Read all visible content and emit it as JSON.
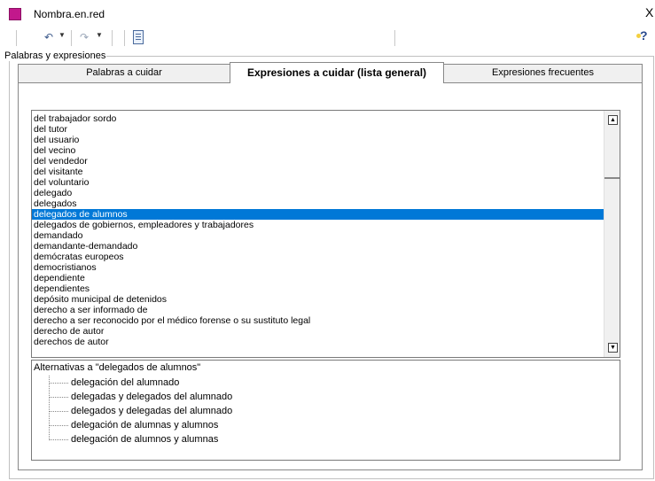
{
  "window": {
    "title": "Nombra.en.red",
    "close_glyph": "X"
  },
  "toolbar": {
    "undo_glyph": "↶",
    "redo_glyph": "↷",
    "dropdown_glyph": "▼",
    "help_glyph": "?"
  },
  "group": {
    "label": "Palabras y expresiones"
  },
  "tabs": [
    {
      "label": "Palabras a cuidar"
    },
    {
      "label": "Expresiones a cuidar (lista general)"
    },
    {
      "label": "Expresiones frecuentes"
    }
  ],
  "active_tab": 1,
  "list": {
    "items": [
      "del trabajador sordo",
      "del tutor",
      "del usuario",
      "del vecino",
      "del vendedor",
      "del visitante",
      "del voluntario",
      "delegado",
      "delegados",
      "delegados de alumnos",
      "delegados de gobiernos, empleadores y trabajadores",
      "demandado",
      "demandante-demandado",
      "demócratas europeos",
      "democristianos",
      "dependiente",
      "dependientes",
      "depósito municipal de detenidos",
      "derecho a ser informado de",
      "derecho a ser reconocido por el médico forense o su sustituto legal",
      "derecho de autor",
      "derechos de autor"
    ],
    "selected_index": 9,
    "scroll_up_glyph": "▲",
    "scroll_down_glyph": "▼"
  },
  "alternatives": {
    "header": "Alternativas a \"delegados de alumnos\"",
    "items": [
      "delegación del alumnado",
      "delegadas y delegados del alumnado",
      "delegados y delegadas del alumnado",
      "delegación de alumnas y alumnos",
      "delegación de alumnos y alumnas"
    ]
  },
  "colors": {
    "selection": "#0078d7",
    "app_icon": "#c2188c"
  }
}
